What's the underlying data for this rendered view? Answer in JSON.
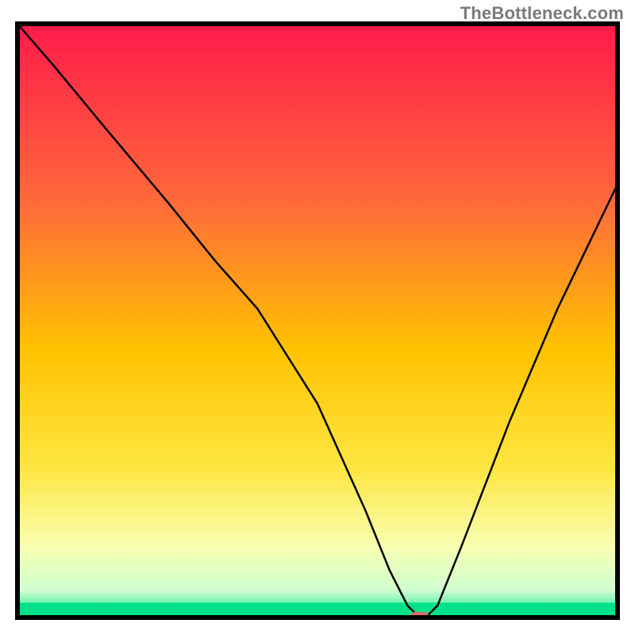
{
  "watermark": "TheBottleneck.com",
  "chart_data": {
    "type": "line",
    "title": "",
    "xlabel": "",
    "ylabel": "",
    "xlim": [
      0,
      100
    ],
    "ylim": [
      0,
      100
    ],
    "axes_visible": false,
    "grid": false,
    "background": {
      "type": "vertical-gradient",
      "stops": [
        {
          "pos": 0.0,
          "color": "#ff1a4b"
        },
        {
          "pos": 0.3,
          "color": "#ff6a3a"
        },
        {
          "pos": 0.55,
          "color": "#ffc300"
        },
        {
          "pos": 0.75,
          "color": "#ffe642"
        },
        {
          "pos": 0.88,
          "color": "#f8ffb0"
        },
        {
          "pos": 0.955,
          "color": "#cfffd0"
        },
        {
          "pos": 1.0,
          "color": "#00e28a"
        }
      ]
    },
    "green_band": {
      "y0": 97.5,
      "y1": 100,
      "color": "#00e28a"
    },
    "series": [
      {
        "name": "curve",
        "color": "#000000",
        "width": 2.5,
        "x": [
          0,
          6,
          15,
          25,
          33,
          40,
          50,
          58,
          62,
          65,
          67,
          68,
          70,
          74,
          82,
          90,
          100
        ],
        "y": [
          100,
          93,
          82,
          70,
          60,
          52,
          36,
          18,
          8,
          2,
          0,
          0,
          2,
          12,
          33,
          52,
          73
        ]
      }
    ],
    "min_marker": {
      "x": 67,
      "y": 0,
      "color": "#e46a6a",
      "rx": 12,
      "ry": 7
    }
  }
}
